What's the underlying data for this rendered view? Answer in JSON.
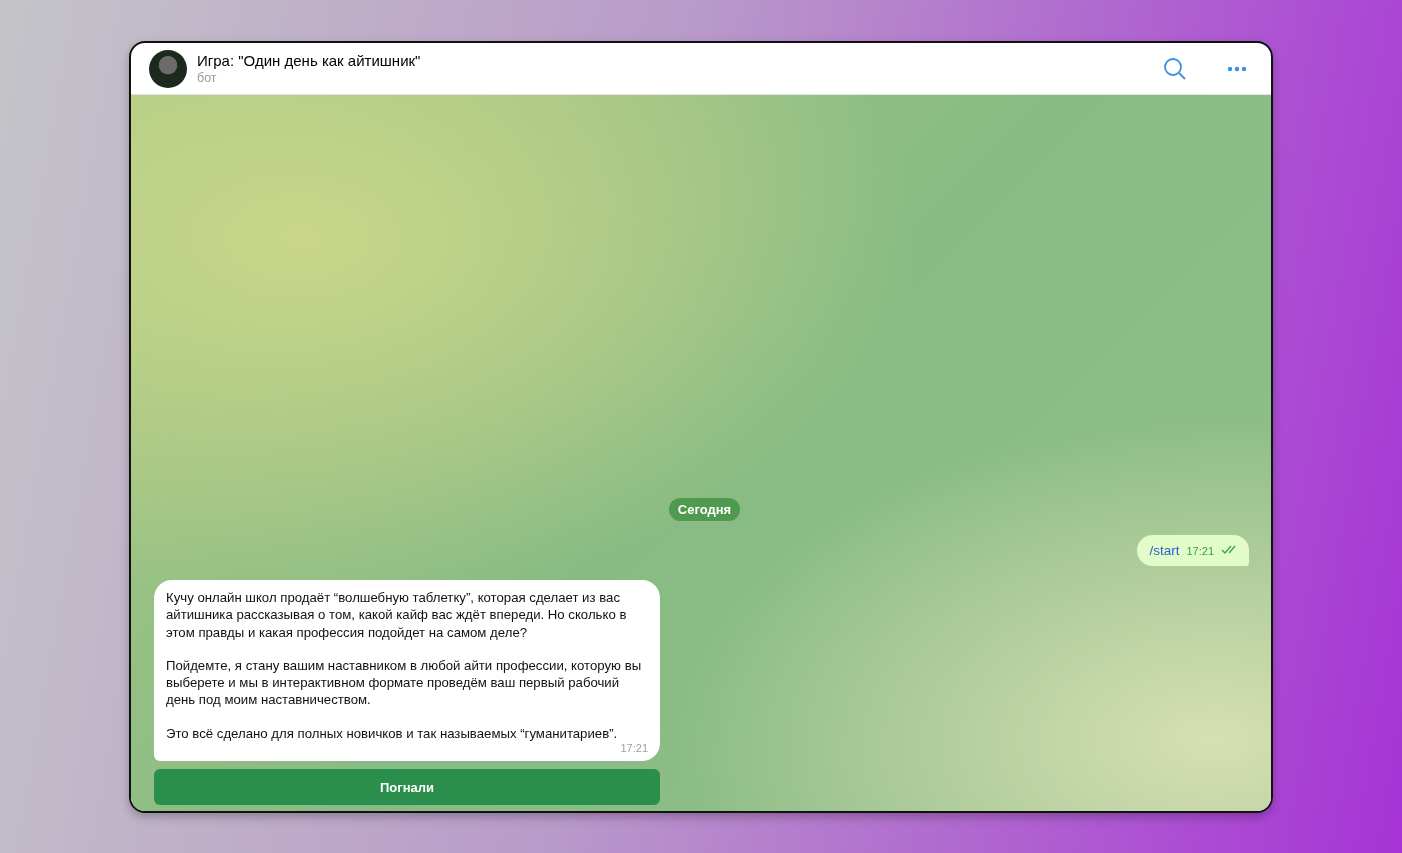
{
  "chat_header": {
    "title": "Игра: \"Один день как айтишник\"",
    "subtitle": "бот"
  },
  "date_divider": "Сегодня",
  "messages": [
    {
      "kind": "outgoing",
      "text": "/start",
      "time": "17:21",
      "read": true
    },
    {
      "kind": "incoming",
      "paragraphs": [
        "Кучу онлайн школ продаёт “волшебную таблетку”, которая сделает из вас айтишника рассказывая о том, какой кайф вас ждёт впереди. Но сколько в этом правды и какая профессия подойдет на самом деле?",
        "Пойдемте, я стану вашим наставником в любой айти профессии, которую вы выберете и мы в интерактивном формате проведём ваш первый рабочий день под моим наставничеством.",
        "Это всё сделано для полных новичков и так называемых “гуманитариев”."
      ],
      "time": "17:21"
    }
  ],
  "keyboard_buttons": [
    "Погнали"
  ]
}
